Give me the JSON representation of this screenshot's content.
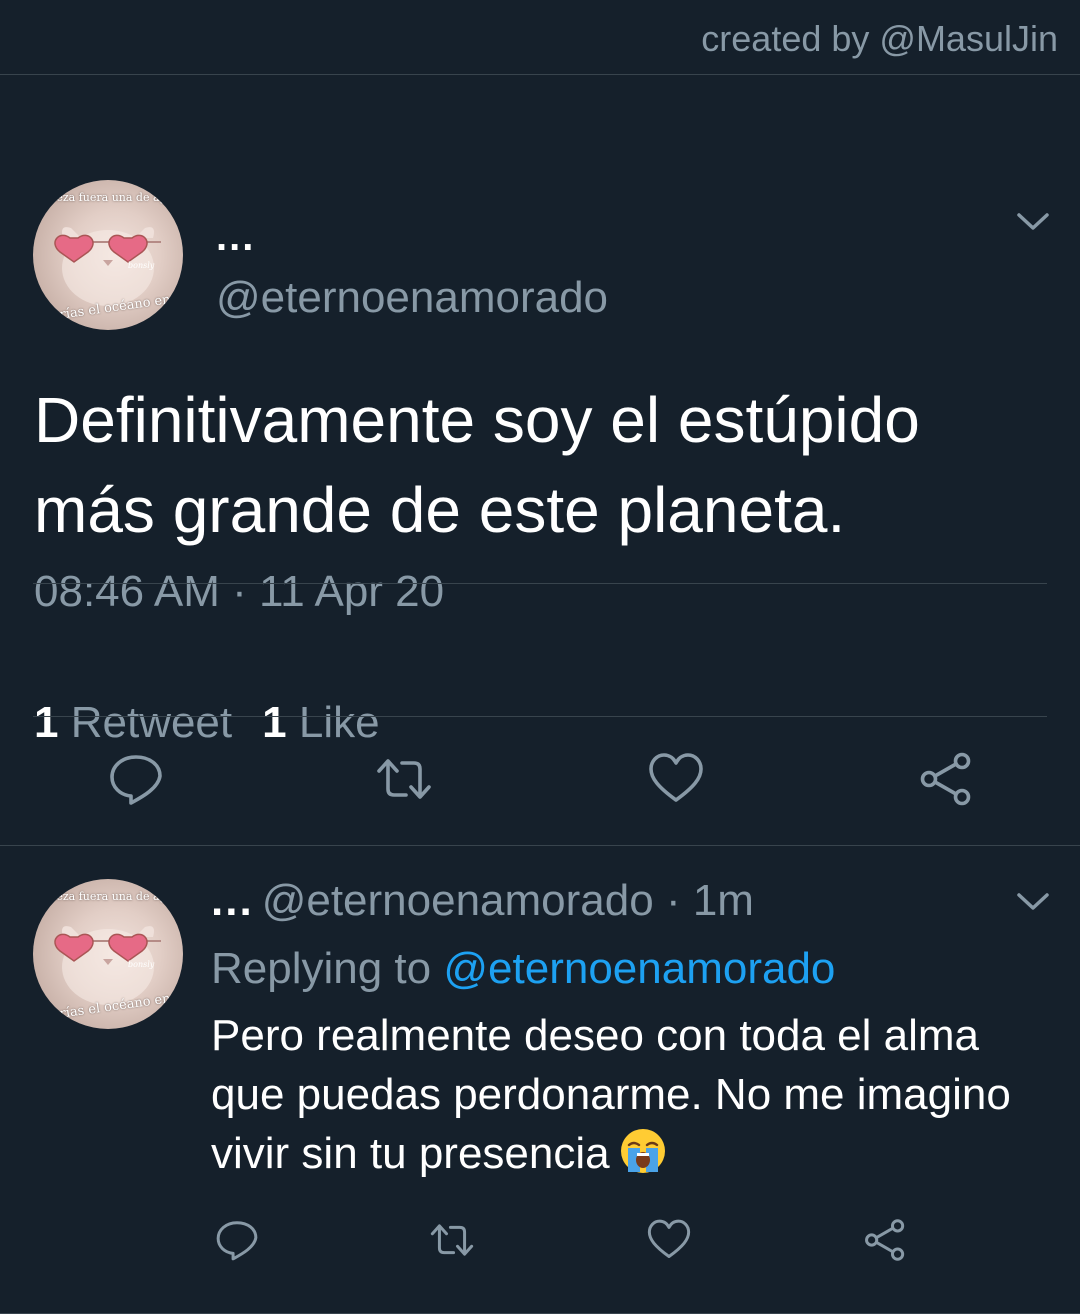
{
  "credit": "created by @MasulJin",
  "main_tweet": {
    "display_name": "...",
    "handle": "@eternoenamorado",
    "avatar_text_top": "belleza fuera una de agua",
    "avatar_text_bottom": "serías el océano en",
    "text": "Definitivamente soy el estúpido más grande de este planeta.",
    "timestamp": "08:46 AM · 11 Apr 20",
    "retweet_count": "1",
    "retweet_label": "Retweet",
    "like_count": "1",
    "like_label": "Like",
    "actions": [
      "reply-icon",
      "retweet-icon",
      "like-icon",
      "share-icon"
    ]
  },
  "reply_tweet": {
    "display_name": "...",
    "handle_time": "@eternoenamorado · 1m",
    "avatar_text_top": "belleza fuera una de agua",
    "avatar_text_bottom": "serías el océano en",
    "replying_label": "Replying to",
    "replying_mention": "@eternoenamorado",
    "text": "Pero realmente deseo con toda el alma que puedas perdonarme. No me imagino vivir sin tu presencia",
    "emoji": "loudly-crying-face",
    "actions": [
      "reply-icon",
      "retweet-icon",
      "like-icon",
      "share-icon"
    ]
  },
  "colors": {
    "background": "#15202b",
    "secondary_text": "#8899a6",
    "divider": "#38444d",
    "accent": "#1da1f2"
  }
}
